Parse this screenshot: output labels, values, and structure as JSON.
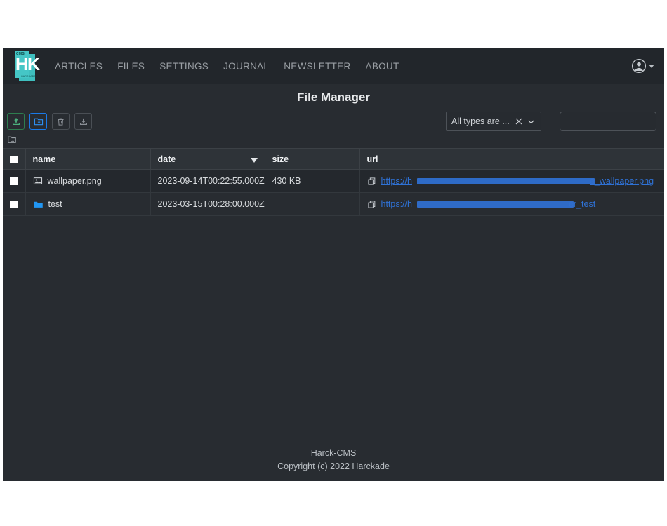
{
  "brand": {
    "logo_top_text": "CMS",
    "logo_main_text": "HK",
    "logo_sub_text": "HARCKADE"
  },
  "nav": {
    "links": [
      {
        "label": "ARTICLES",
        "name": "nav-link-articles"
      },
      {
        "label": "FILES",
        "name": "nav-link-files"
      },
      {
        "label": "SETTINGS",
        "name": "nav-link-settings"
      },
      {
        "label": "JOURNAL",
        "name": "nav-link-journal"
      },
      {
        "label": "NEWSLETTER",
        "name": "nav-link-newsletter"
      },
      {
        "label": "ABOUT",
        "name": "nav-link-about"
      }
    ],
    "account_icon": "user-avatar-icon",
    "account_caret_icon": "chevron-down-icon"
  },
  "page": {
    "title": "File Manager"
  },
  "toolbar": {
    "buttons": [
      {
        "name": "upload-file-button",
        "icon": "upload-icon",
        "state": "enabled",
        "accent": "#2e7d4f"
      },
      {
        "name": "new-folder-button",
        "icon": "folder-plus-icon",
        "state": "enabled",
        "accent": "#1a7ae8"
      },
      {
        "name": "delete-button",
        "icon": "trash-icon",
        "state": "disabled",
        "accent": "#4a4f55"
      },
      {
        "name": "download-button",
        "icon": "download-icon",
        "state": "disabled",
        "accent": "#4a4f55"
      }
    ],
    "type_filter": {
      "value": "All types are ...",
      "clear_icon": "close-icon",
      "expand_icon": "chevron-down-icon"
    },
    "search": {
      "value": "",
      "placeholder": ""
    }
  },
  "breadcrumb": {
    "icon": "folder-root-icon"
  },
  "table": {
    "select_all_checked": false,
    "columns": [
      {
        "key": "check",
        "label": ""
      },
      {
        "key": "name",
        "label": "name"
      },
      {
        "key": "date",
        "label": "date",
        "sorted": "desc",
        "sort_icon": "sort-descending-icon"
      },
      {
        "key": "size",
        "label": "size"
      },
      {
        "key": "url",
        "label": "url"
      }
    ],
    "rows": [
      {
        "checked": false,
        "icon": "image-file-icon",
        "name": "wallpaper.png",
        "date": "2023-09-14T00:22:55.000Z",
        "size": "430 KB",
        "url_prefix": "https://h",
        "url_suffix": "e_wallpaper.png",
        "url_redacted": true,
        "copy_icon": "copy-icon"
      },
      {
        "checked": false,
        "icon": "folder-icon",
        "name": "test",
        "date": "2023-03-15T00:28:00.000Z",
        "size": "",
        "url_prefix": "https://h",
        "url_suffix": "er_test",
        "url_redacted": true,
        "copy_icon": "copy-icon"
      }
    ]
  },
  "footer": {
    "line1": "Harck-CMS",
    "line2": "Copyright (c) 2022 Harckade"
  },
  "colors": {
    "page_bg": "#ffffff",
    "app_bg": "#282c31",
    "navbar_bg": "#22262b",
    "table_header_bg": "#2e3338",
    "accent_teal": "#45c6c6",
    "accent_green": "#2e7d4f",
    "accent_blue": "#1a7ae8",
    "link_blue": "#2f72d6",
    "folder_blue": "#2196f3"
  }
}
